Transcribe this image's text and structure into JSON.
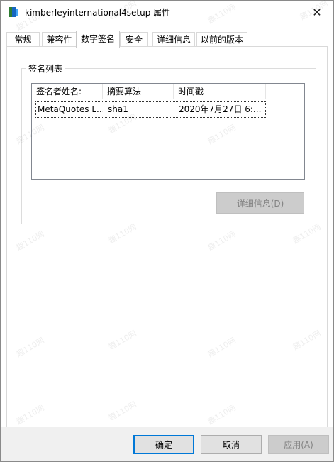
{
  "window": {
    "title": "kimberleyinternational4setup 属性",
    "close_glyph": "✕"
  },
  "tabs": [
    {
      "label": "常规"
    },
    {
      "label": "兼容性"
    },
    {
      "label": "数字签名",
      "active": true
    },
    {
      "label": "安全"
    },
    {
      "label": "详细信息"
    },
    {
      "label": "以前的版本"
    }
  ],
  "signature_group": {
    "legend": "签名列表",
    "columns": [
      "签名者姓名:",
      "摘要算法",
      "时间戳"
    ],
    "rows": [
      {
        "signer": "MetaQuotes L...",
        "digest": "sha1",
        "timestamp": "2020年7月27日 6:..."
      }
    ],
    "details_button": "详细信息(D)"
  },
  "footer": {
    "ok": "确定",
    "cancel": "取消",
    "apply": "应用(A)"
  },
  "watermark_text": "趣110网"
}
